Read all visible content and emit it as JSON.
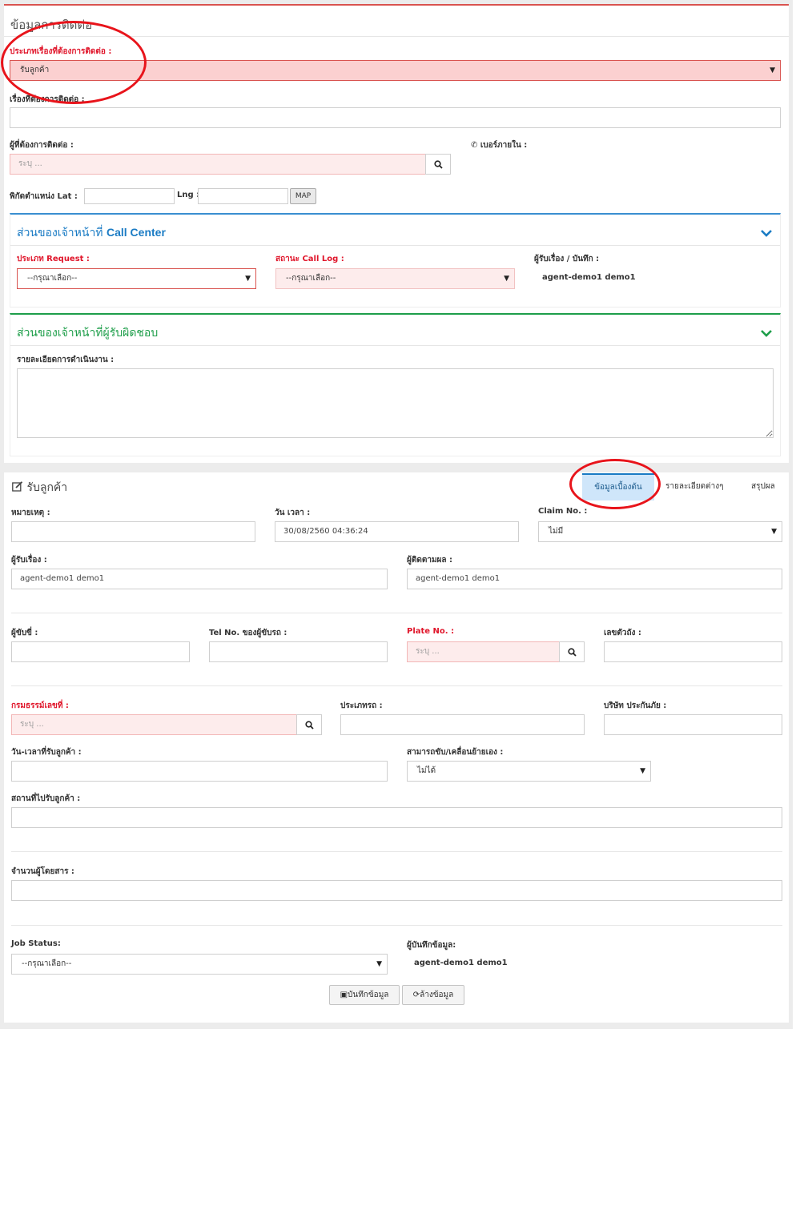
{
  "contact_section": {
    "title": "ข้อมูลการติดต่อ",
    "topic_type_label": "ประเภทเรื่องที่ต้องการติดต่อ :",
    "topic_type_value": "รับลูกค้า",
    "topic_label": "เรื่องที่ต้องการติดต่อ :",
    "contact_person_label": "ผู้ที่ต้องการติดต่อ :",
    "contact_person_placeholder": "ระบุ ...",
    "extension_label": "เบอร์ภายใน :",
    "coords_label": "พิกัดตำแหน่ง Lat :",
    "lng_label": "Lng :",
    "map_button": "MAP"
  },
  "call_center": {
    "title_prefix": "ส่วนของเจ้าหน้าที่ ",
    "title_suffix": "Call Center",
    "request_type_label": "ประเภท Request :",
    "request_type_value": "--กรุณาเลือก--",
    "call_log_label": "สถานะ Call Log :",
    "call_log_value": "--กรุณาเลือก--",
    "recorder_label": "ผู้รับเรื่อง / บันทึก :",
    "recorder_value": "agent-demo1 demo1"
  },
  "responsible": {
    "title": "ส่วนของเจ้าหน้าที่ผู้รับผิดชอบ",
    "details_label": "รายละเอียดการดำเนินงาน :"
  },
  "customer": {
    "title": "รับลูกค้า",
    "tabs": [
      "ข้อมูลเบื้องต้น",
      "รายละเอียดต่างๆ",
      "สรุปผล"
    ],
    "note_label": "หมายเหตุ :",
    "datetime_label": "วัน เวลา :",
    "datetime_value": "30/08/2560 04:36:24",
    "claim_label": "Claim No. :",
    "claim_value": "ไม่มี",
    "receiver_label": "ผู้รับเรื่อง :",
    "receiver_value": "agent-demo1 demo1",
    "follower_label": "ผู้ติดตามผล :",
    "follower_value": "agent-demo1 demo1",
    "driver_label": "ผู้ขับขี่ :",
    "driver_tel_label": "Tel No. ของผู้ขับรถ :",
    "plate_label": "Plate No. :",
    "plate_placeholder": "ระบุ ...",
    "chassis_label": "เลขตัวถัง :",
    "policy_label": "กรมธรรม์เลขที่ :",
    "policy_placeholder": "ระบุ ...",
    "car_type_label": "ประเภทรถ :",
    "insurer_label": "บริษัท ประกันภัย :",
    "pickup_datetime_label": "วัน-เวลาที่รับลูกค้า :",
    "drivable_label": "สามารถขับ/เคลื่อนย้ายเอง :",
    "drivable_value": "ไม่ได้",
    "pickup_place_label": "สถานที่ไปรับลูกค้า :",
    "passengers_label": "จำนวนผู้โดยสาร :",
    "job_status_label": "Job Status:",
    "job_status_value": "--กรุณาเลือก--",
    "recorder_label": "ผู้บันทึกข้อมูล:",
    "recorder_value": "agent-demo1 demo1",
    "save_button": "บันทึกข้อมูล",
    "clear_button": "ล้างข้อมูล"
  },
  "colors": {
    "accent_red": "#e0152a",
    "call_center_blue": "#1a7bc4",
    "responsible_green": "#1e9e4a",
    "active_tab_bg": "#cfe6fa"
  },
  "icons": [
    "chevron-down-icon",
    "search-icon",
    "phone-icon",
    "edit-icon",
    "save-icon",
    "refresh-icon"
  ]
}
